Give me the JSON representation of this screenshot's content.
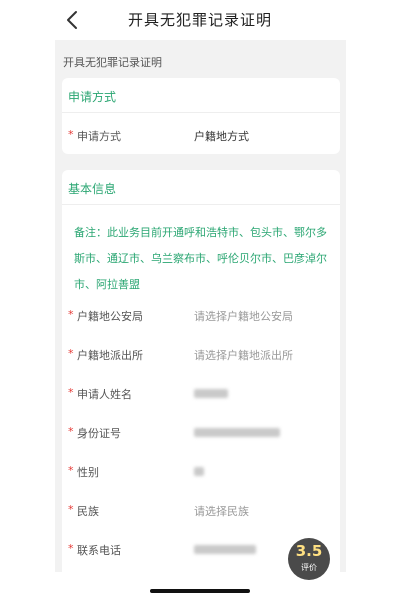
{
  "header": {
    "title": "开具无犯罪记录证明"
  },
  "section_label": "开具无犯罪记录证明",
  "apply_method": {
    "title": "申请方式",
    "field": {
      "label": "申请方式",
      "value": "户籍地方式"
    }
  },
  "basic_info": {
    "title": "基本信息",
    "note": "备注：此业务目前开通呼和浩特市、包头市、鄂尔多斯市、通辽市、乌兰察布市、呼伦贝尔市、巴彦淖尔市、阿拉善盟",
    "fields": [
      {
        "label": "户籍地公安局",
        "placeholder": "请选择户籍地公安局"
      },
      {
        "label": "户籍地派出所",
        "placeholder": "请选择户籍地派出所"
      },
      {
        "label": "申请人姓名"
      },
      {
        "label": "身份证号"
      },
      {
        "label": "性别"
      },
      {
        "label": "民族",
        "placeholder": "请选择民族"
      },
      {
        "label": "联系电话"
      }
    ]
  },
  "rating": {
    "score": "3.5",
    "label": "评价"
  },
  "colors": {
    "accent": "#2aa672",
    "required": "#e53935",
    "page_bg": "#f2f2f2"
  },
  "icons": {
    "back": "chevron-left-icon"
  }
}
